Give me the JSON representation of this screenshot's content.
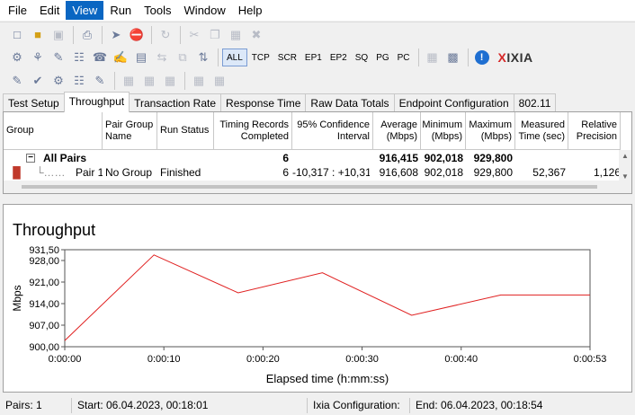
{
  "menu": [
    "File",
    "Edit",
    "View",
    "Run",
    "Tools",
    "Window",
    "Help"
  ],
  "active_menu": "View",
  "toolbar": {
    "filters": [
      "ALL",
      "TCP",
      "SCR",
      "EP1",
      "EP2",
      "SQ",
      "PG",
      "PC"
    ],
    "active_filter": "ALL",
    "brand": {
      "prefix": "",
      "x": "X",
      "rest": "IXIA"
    }
  },
  "tabs": [
    "Test Setup",
    "Throughput",
    "Transaction Rate",
    "Response Time",
    "Raw Data Totals",
    "Endpoint Configuration",
    "802.11"
  ],
  "active_tab": "Throughput",
  "grid": {
    "headers": {
      "group": "Group",
      "pair_group_name": "Pair Group Name",
      "run_status": "Run Status",
      "timing_records": "Timing Records Completed",
      "confidence": "95% Confidence Interval",
      "average": "Average (Mbps)",
      "minimum": "Minimum (Mbps)",
      "maximum": "Maximum (Mbps)",
      "measured_time": "Measured Time (sec)",
      "relative_precision": "Relative Precision"
    },
    "rows": [
      {
        "group": "All Pairs",
        "pair_group_name": "",
        "run_status": "",
        "timing_records": "6",
        "confidence": "",
        "average": "916,415",
        "minimum": "902,018",
        "maximum": "929,800",
        "measured_time": "",
        "relative_precision": ""
      },
      {
        "group": "Pair 1",
        "pair_group_name": "No Group",
        "run_status": "Finished",
        "timing_records": "6",
        "confidence": "-10,317 : +10,317",
        "average": "916,608",
        "minimum": "902,018",
        "maximum": "929,800",
        "measured_time": "52,367",
        "relative_precision": "1,126"
      }
    ]
  },
  "chart_data": {
    "type": "line",
    "title": "Throughput",
    "xlabel": "Elapsed time (h:mm:ss)",
    "ylabel": "Mbps",
    "yticks": [
      "900,00",
      "907,00",
      "914,00",
      "921,00",
      "928,00",
      "931,50"
    ],
    "ytick_values": [
      900,
      907,
      914,
      921,
      928,
      931.5
    ],
    "ylim": [
      900,
      931.5
    ],
    "xticks": [
      "0:00:00",
      "0:00:10",
      "0:00:20",
      "0:00:30",
      "0:00:40",
      "0:00:53"
    ],
    "xtick_values": [
      0,
      10,
      20,
      30,
      40,
      53
    ],
    "xlim": [
      0,
      53
    ],
    "series": [
      {
        "color": "#e02020",
        "x": [
          0,
          9,
          17.5,
          26,
          35,
          44,
          53
        ],
        "y": [
          902.0,
          929.8,
          917.5,
          924.0,
          910.2,
          916.8,
          916.8
        ]
      }
    ],
    "grid": false
  },
  "status": {
    "pairs": "Pairs: 1",
    "start": "Start: 06.04.2023, 00:18:01",
    "ixia_config": "Ixia Configuration:",
    "end": "End: 06.04.2023, 00:18:54"
  }
}
